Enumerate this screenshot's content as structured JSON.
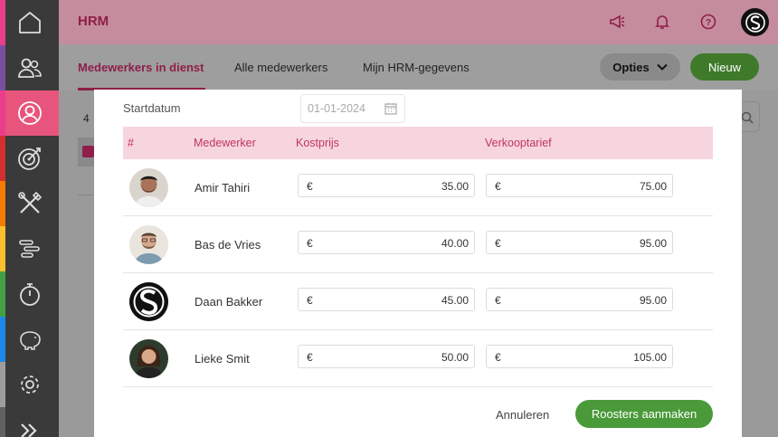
{
  "app": {
    "title": "HRM"
  },
  "colors": {
    "brand": "#c0365f",
    "primary_green": "#4a9a3a",
    "header_row": "#f7d5de"
  },
  "sidebar": {
    "items": [
      {
        "icon": "home-icon",
        "stripe": "#e83e8c"
      },
      {
        "icon": "users-icon",
        "stripe": "#7b4fa0"
      },
      {
        "icon": "user-circle-icon",
        "stripe": "#e83e8c",
        "active": true
      },
      {
        "icon": "target-icon",
        "stripe": "#d32f2f"
      },
      {
        "icon": "tools-icon",
        "stripe": "#f57c00"
      },
      {
        "icon": "planning-icon",
        "stripe": "#fbc02d"
      },
      {
        "icon": "stopwatch-icon",
        "stripe": "#43a047"
      },
      {
        "icon": "piggy-bank-icon",
        "stripe": "#1e88e5"
      },
      {
        "icon": "gear-icon",
        "stripe": "#9e9e9e"
      },
      {
        "icon": "expand-icon",
        "stripe": "#616161"
      }
    ]
  },
  "header": {
    "icons": [
      "megaphone-icon",
      "bell-icon",
      "help-icon"
    ]
  },
  "tabs": [
    {
      "label": "Medewerkers in dienst",
      "active": true
    },
    {
      "label": "Alle medewerkers"
    },
    {
      "label": "Mijn HRM-gegevens"
    }
  ],
  "toolbar": {
    "options_label": "Opties",
    "new_label": "Nieuw"
  },
  "background": {
    "count": "4"
  },
  "modal": {
    "start_label": "Startdatum",
    "start_value": "01-01-2024",
    "columns": [
      "#",
      "Medewerker",
      "Kostprijs",
      "Verkooptarief"
    ],
    "currency": "€",
    "rows": [
      {
        "name": "Amir Tahiri",
        "cost": "35.00",
        "rate": "75.00"
      },
      {
        "name": "Bas de Vries",
        "cost": "40.00",
        "rate": "95.00"
      },
      {
        "name": "Daan Bakker",
        "cost": "45.00",
        "rate": "95.00"
      },
      {
        "name": "Lieke Smit",
        "cost": "50.00",
        "rate": "105.00"
      }
    ],
    "cancel_label": "Annuleren",
    "submit_label": "Roosters aanmaken"
  }
}
